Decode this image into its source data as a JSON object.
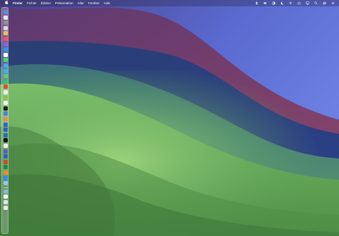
{
  "menubar": {
    "apple": "",
    "items": [
      "Finder",
      "Fichier",
      "Édition",
      "Présentation",
      "Aller",
      "Fenêtre",
      "Aide"
    ],
    "status_icons": [
      "dropbox-icon",
      "battery-icon",
      "contrast-icon",
      "focus-icon",
      "wifi-icon",
      "headphones-icon",
      "airplay-icon",
      "search-icon",
      "control-center-icon",
      "siri-icon"
    ]
  },
  "dock": {
    "apps": [
      {
        "name": "finder-icon",
        "color": "#4f8fe8"
      },
      {
        "name": "launchpad-icon",
        "color": "#e6e6ea"
      },
      {
        "name": "settings-icon",
        "color": "#8e8e93"
      },
      {
        "name": "notes-icon",
        "color": "#d8d2f2"
      },
      {
        "name": "photos-icon",
        "color": "#f2c14e"
      },
      {
        "name": "music-icon",
        "color": "#ef4f6a"
      },
      {
        "name": "podcasts-icon",
        "color": "#9b59d6"
      },
      {
        "name": "appstore-icon",
        "color": "#3a8ef0"
      },
      {
        "name": "calendar-icon",
        "color": "#ffffff"
      },
      {
        "name": "messages-icon",
        "color": "#4cd964"
      },
      {
        "name": "mail-icon",
        "color": "#4aa8f0"
      },
      {
        "name": "safari-icon",
        "color": "#3bb2f5"
      },
      {
        "name": "maps-icon",
        "color": "#6cc56b"
      },
      {
        "name": "facetime-icon",
        "color": "#34c759"
      },
      {
        "name": "chrome-icon",
        "color": "#e94335"
      },
      {
        "name": "reminders-icon",
        "color": "#f0f0f0"
      },
      {
        "name": "folder-icon",
        "color": "#8bc34a"
      },
      {
        "name": "textedit-icon",
        "color": "#f7f7f2"
      },
      {
        "name": "terminal-icon",
        "color": "#1e1e1e"
      },
      {
        "name": "keynote-icon",
        "color": "#3f83e6"
      },
      {
        "name": "numbers-icon",
        "color": "#f08c3c"
      },
      {
        "name": "pages-icon",
        "color": "#2f63c8"
      },
      {
        "name": "xcode-icon",
        "color": "#2c62c7"
      },
      {
        "name": "vscode-icon",
        "color": "#1f6fbf"
      },
      {
        "name": "x-icon",
        "color": "#111111"
      },
      {
        "name": "slack-icon",
        "color": "#eeeeee"
      },
      {
        "name": "teams-icon",
        "color": "#5b5fc7"
      },
      {
        "name": "word-icon",
        "color": "#2b64c5"
      },
      {
        "name": "powerpoint-icon",
        "color": "#d24625"
      },
      {
        "name": "excel-icon",
        "color": "#1f8a4c"
      },
      {
        "name": "vlc-icon",
        "color": "#f08a24"
      },
      {
        "name": "zoom-icon",
        "color": "#2d8cff"
      },
      {
        "name": "preview-icon",
        "color": "#8cc7f0"
      }
    ],
    "trailing": [
      {
        "name": "downloads-folder-icon",
        "color": "#7fb8ee"
      },
      {
        "name": "document-icon",
        "color": "#f5f5f5"
      },
      {
        "name": "screenshot-icon",
        "color": "#d9e8f7"
      },
      {
        "name": "trash-icon",
        "color": "#e8eaec"
      }
    ]
  }
}
